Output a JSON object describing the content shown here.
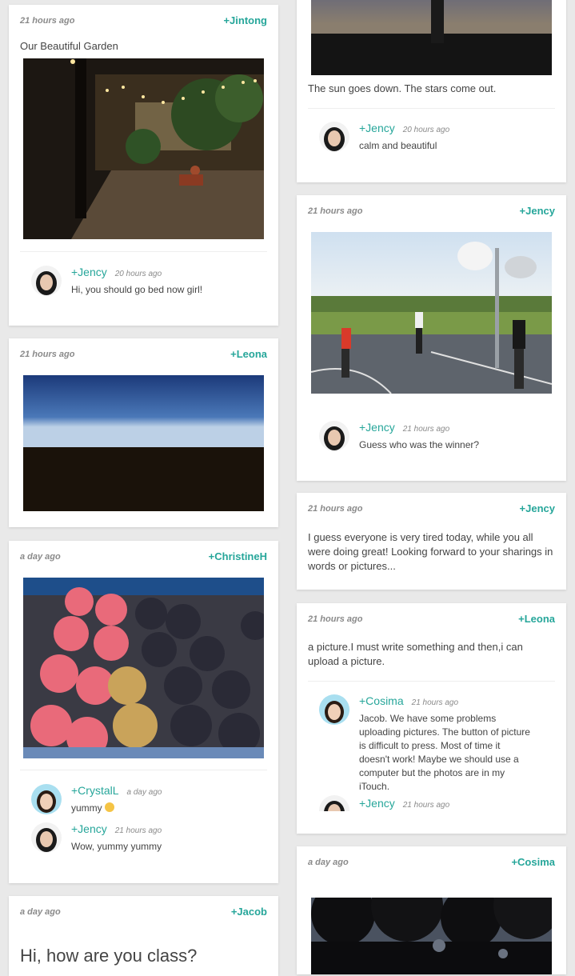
{
  "cards": {
    "garden": {
      "time": "21 hours ago",
      "author": "+Jintong",
      "title": "Our Beautiful Garden",
      "comment": {
        "name": "+Jency",
        "time": "20 hours ago",
        "text": "Hi, you should go bed now girl!"
      }
    },
    "sunset": {
      "caption": "The sun goes down. The stars come out.",
      "comment": {
        "name": "+Jency",
        "time": "20 hours ago",
        "text": "calm and beautiful"
      }
    },
    "night": {
      "time": "21 hours ago",
      "author": "+Leona"
    },
    "basketball": {
      "time": "21 hours ago",
      "author": "+Jency",
      "comment": {
        "name": "+Jency",
        "time": "21 hours ago",
        "text": "Guess who was the winner?"
      }
    },
    "tired": {
      "time": "21 hours ago",
      "author": "+Jency",
      "text": "I guess everyone is very tired today, while you all were doing great! Looking forward to your sharings in words or pictures..."
    },
    "donuts": {
      "time": "a day ago",
      "author": "+ChristineH",
      "comments": [
        {
          "name": "+CrystalL",
          "time": "a day ago",
          "text": "yummy"
        },
        {
          "name": "+Jency",
          "time": "21 hours ago",
          "text": "Wow, yummy yummy"
        }
      ]
    },
    "upload": {
      "time": "21 hours ago",
      "author": "+Leona",
      "text": "a picture.I must write something and then,i can upload a picture.",
      "comments": [
        {
          "name": "+Cosima",
          "time": "21 hours ago",
          "text": "Jacob. We have some problems uploading pictures. The button of picture is difficult to press. Most of time it doesn't work! Maybe we should use a computer but the photos are in my iTouch."
        },
        {
          "name": "+Jency",
          "time": "21 hours ago"
        }
      ]
    },
    "greeting": {
      "time": "a day ago",
      "author": "+Jacob",
      "text": "Hi, how are you class?"
    },
    "cosima": {
      "time": "a day ago",
      "author": "+Cosima"
    }
  },
  "colors": {
    "accent": "#26a69a",
    "background": "#e9e9e9",
    "card": "#ffffff"
  }
}
